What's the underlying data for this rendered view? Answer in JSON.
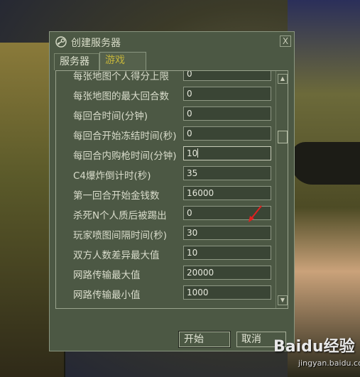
{
  "window": {
    "title": "创建服务器",
    "close_label": "X",
    "icon": "steam-icon"
  },
  "tabs": [
    {
      "label": "服务器",
      "active": false
    },
    {
      "label": "游戏",
      "active": true
    }
  ],
  "settings": [
    {
      "label": "每张地图个人得分上限",
      "value": "0"
    },
    {
      "label": "每张地图的最大回合数",
      "value": "0"
    },
    {
      "label": "每回合时间(分钟)",
      "value": "0"
    },
    {
      "label": "每回合开始冻结时间(秒)",
      "value": "0"
    },
    {
      "label": "每回合内购枪时间(分钟)",
      "value": "10"
    },
    {
      "label": "C4爆炸倒计时(秒)",
      "value": "35"
    },
    {
      "label": "第一回合开始金钱数",
      "value": "16000"
    },
    {
      "label": "杀死N个人质后被踢出",
      "value": "0"
    },
    {
      "label": "玩家喷图间隔时间(秒)",
      "value": "30"
    },
    {
      "label": "双方人数差异最大值",
      "value": "10"
    },
    {
      "label": "网路传输最大值",
      "value": "20000"
    },
    {
      "label": "网路传输最小值",
      "value": "1000"
    }
  ],
  "buttons": {
    "start": "开始",
    "cancel": "取消"
  },
  "scroll_icons": {
    "up": "▲",
    "down": "▼"
  },
  "watermark": {
    "logo": "Baidu经验",
    "sub": "jingyan.baidu.com"
  },
  "colors": {
    "dialog_bg": "#4c5844",
    "active_tab_text": "#c4b43a",
    "annotation_arrow": "#e02020"
  }
}
